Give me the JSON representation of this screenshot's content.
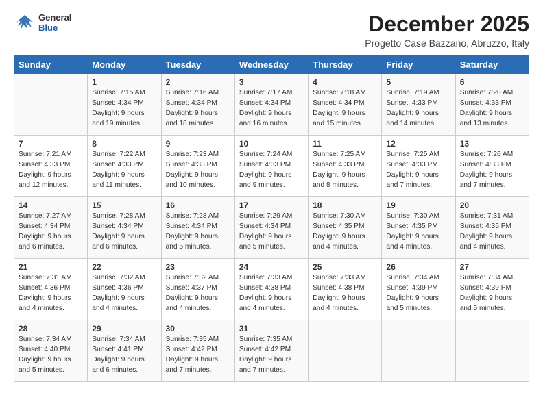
{
  "logo": {
    "line1": "General",
    "line2": "Blue"
  },
  "title": "December 2025",
  "subtitle": "Progetto Case Bazzano, Abruzzo, Italy",
  "days_of_week": [
    "Sunday",
    "Monday",
    "Tuesday",
    "Wednesday",
    "Thursday",
    "Friday",
    "Saturday"
  ],
  "weeks": [
    [
      {
        "day": "",
        "sunrise": "",
        "sunset": "",
        "daylight": ""
      },
      {
        "day": "1",
        "sunrise": "Sunrise: 7:15 AM",
        "sunset": "Sunset: 4:34 PM",
        "daylight": "Daylight: 9 hours and 19 minutes."
      },
      {
        "day": "2",
        "sunrise": "Sunrise: 7:16 AM",
        "sunset": "Sunset: 4:34 PM",
        "daylight": "Daylight: 9 hours and 18 minutes."
      },
      {
        "day": "3",
        "sunrise": "Sunrise: 7:17 AM",
        "sunset": "Sunset: 4:34 PM",
        "daylight": "Daylight: 9 hours and 16 minutes."
      },
      {
        "day": "4",
        "sunrise": "Sunrise: 7:18 AM",
        "sunset": "Sunset: 4:34 PM",
        "daylight": "Daylight: 9 hours and 15 minutes."
      },
      {
        "day": "5",
        "sunrise": "Sunrise: 7:19 AM",
        "sunset": "Sunset: 4:33 PM",
        "daylight": "Daylight: 9 hours and 14 minutes."
      },
      {
        "day": "6",
        "sunrise": "Sunrise: 7:20 AM",
        "sunset": "Sunset: 4:33 PM",
        "daylight": "Daylight: 9 hours and 13 minutes."
      }
    ],
    [
      {
        "day": "7",
        "sunrise": "Sunrise: 7:21 AM",
        "sunset": "Sunset: 4:33 PM",
        "daylight": "Daylight: 9 hours and 12 minutes."
      },
      {
        "day": "8",
        "sunrise": "Sunrise: 7:22 AM",
        "sunset": "Sunset: 4:33 PM",
        "daylight": "Daylight: 9 hours and 11 minutes."
      },
      {
        "day": "9",
        "sunrise": "Sunrise: 7:23 AM",
        "sunset": "Sunset: 4:33 PM",
        "daylight": "Daylight: 9 hours and 10 minutes."
      },
      {
        "day": "10",
        "sunrise": "Sunrise: 7:24 AM",
        "sunset": "Sunset: 4:33 PM",
        "daylight": "Daylight: 9 hours and 9 minutes."
      },
      {
        "day": "11",
        "sunrise": "Sunrise: 7:25 AM",
        "sunset": "Sunset: 4:33 PM",
        "daylight": "Daylight: 9 hours and 8 minutes."
      },
      {
        "day": "12",
        "sunrise": "Sunrise: 7:25 AM",
        "sunset": "Sunset: 4:33 PM",
        "daylight": "Daylight: 9 hours and 7 minutes."
      },
      {
        "day": "13",
        "sunrise": "Sunrise: 7:26 AM",
        "sunset": "Sunset: 4:33 PM",
        "daylight": "Daylight: 9 hours and 7 minutes."
      }
    ],
    [
      {
        "day": "14",
        "sunrise": "Sunrise: 7:27 AM",
        "sunset": "Sunset: 4:34 PM",
        "daylight": "Daylight: 9 hours and 6 minutes."
      },
      {
        "day": "15",
        "sunrise": "Sunrise: 7:28 AM",
        "sunset": "Sunset: 4:34 PM",
        "daylight": "Daylight: 9 hours and 6 minutes."
      },
      {
        "day": "16",
        "sunrise": "Sunrise: 7:28 AM",
        "sunset": "Sunset: 4:34 PM",
        "daylight": "Daylight: 9 hours and 5 minutes."
      },
      {
        "day": "17",
        "sunrise": "Sunrise: 7:29 AM",
        "sunset": "Sunset: 4:34 PM",
        "daylight": "Daylight: 9 hours and 5 minutes."
      },
      {
        "day": "18",
        "sunrise": "Sunrise: 7:30 AM",
        "sunset": "Sunset: 4:35 PM",
        "daylight": "Daylight: 9 hours and 4 minutes."
      },
      {
        "day": "19",
        "sunrise": "Sunrise: 7:30 AM",
        "sunset": "Sunset: 4:35 PM",
        "daylight": "Daylight: 9 hours and 4 minutes."
      },
      {
        "day": "20",
        "sunrise": "Sunrise: 7:31 AM",
        "sunset": "Sunset: 4:35 PM",
        "daylight": "Daylight: 9 hours and 4 minutes."
      }
    ],
    [
      {
        "day": "21",
        "sunrise": "Sunrise: 7:31 AM",
        "sunset": "Sunset: 4:36 PM",
        "daylight": "Daylight: 9 hours and 4 minutes."
      },
      {
        "day": "22",
        "sunrise": "Sunrise: 7:32 AM",
        "sunset": "Sunset: 4:36 PM",
        "daylight": "Daylight: 9 hours and 4 minutes."
      },
      {
        "day": "23",
        "sunrise": "Sunrise: 7:32 AM",
        "sunset": "Sunset: 4:37 PM",
        "daylight": "Daylight: 9 hours and 4 minutes."
      },
      {
        "day": "24",
        "sunrise": "Sunrise: 7:33 AM",
        "sunset": "Sunset: 4:38 PM",
        "daylight": "Daylight: 9 hours and 4 minutes."
      },
      {
        "day": "25",
        "sunrise": "Sunrise: 7:33 AM",
        "sunset": "Sunset: 4:38 PM",
        "daylight": "Daylight: 9 hours and 4 minutes."
      },
      {
        "day": "26",
        "sunrise": "Sunrise: 7:34 AM",
        "sunset": "Sunset: 4:39 PM",
        "daylight": "Daylight: 9 hours and 5 minutes."
      },
      {
        "day": "27",
        "sunrise": "Sunrise: 7:34 AM",
        "sunset": "Sunset: 4:39 PM",
        "daylight": "Daylight: 9 hours and 5 minutes."
      }
    ],
    [
      {
        "day": "28",
        "sunrise": "Sunrise: 7:34 AM",
        "sunset": "Sunset: 4:40 PM",
        "daylight": "Daylight: 9 hours and 5 minutes."
      },
      {
        "day": "29",
        "sunrise": "Sunrise: 7:34 AM",
        "sunset": "Sunset: 4:41 PM",
        "daylight": "Daylight: 9 hours and 6 minutes."
      },
      {
        "day": "30",
        "sunrise": "Sunrise: 7:35 AM",
        "sunset": "Sunset: 4:42 PM",
        "daylight": "Daylight: 9 hours and 7 minutes."
      },
      {
        "day": "31",
        "sunrise": "Sunrise: 7:35 AM",
        "sunset": "Sunset: 4:42 PM",
        "daylight": "Daylight: 9 hours and 7 minutes."
      },
      {
        "day": "",
        "sunrise": "",
        "sunset": "",
        "daylight": ""
      },
      {
        "day": "",
        "sunrise": "",
        "sunset": "",
        "daylight": ""
      },
      {
        "day": "",
        "sunrise": "",
        "sunset": "",
        "daylight": ""
      }
    ]
  ]
}
